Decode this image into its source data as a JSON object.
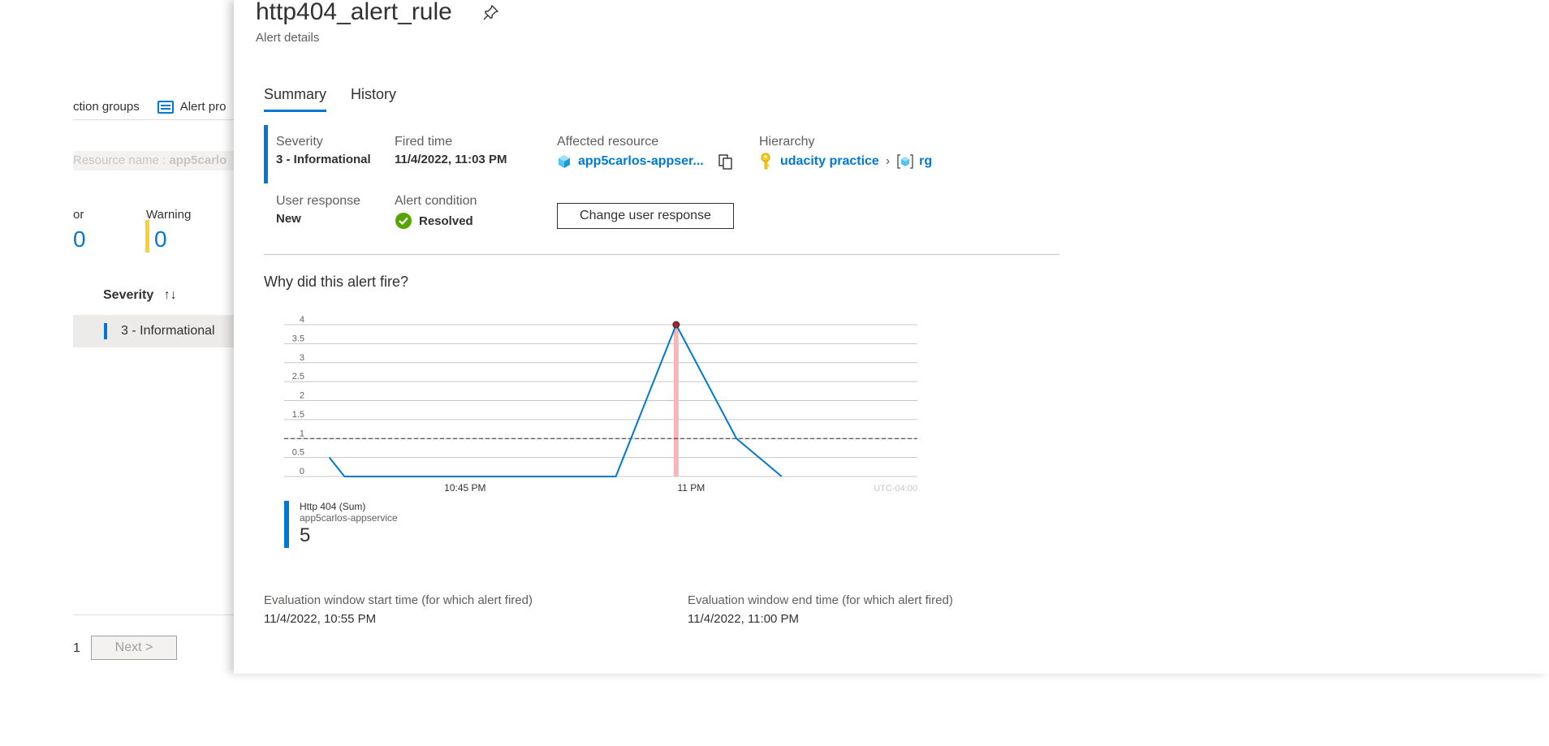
{
  "background": {
    "toolbar": {
      "action_groups": "ction groups",
      "alert_processing": "Alert pro"
    },
    "filter": {
      "prefix": "Resource name : ",
      "value": "app5carlo"
    },
    "stats": [
      {
        "label": "or",
        "value": "0"
      },
      {
        "label": "Warning",
        "value": "0"
      }
    ],
    "severity_header": "Severity",
    "sort_icon": "sort-updown-icon",
    "severity_row": "3 - Informational",
    "pagination": {
      "page": "1",
      "next_label": "Next >"
    }
  },
  "blade": {
    "title": "http404_alert_rule",
    "subtitle": "Alert details",
    "pin_icon": "pin-icon",
    "tabs": [
      {
        "label": "Summary",
        "active": true
      },
      {
        "label": "History",
        "active": false
      }
    ],
    "summary": {
      "severity": {
        "label": "Severity",
        "value": "3 - Informational"
      },
      "fired_time": {
        "label": "Fired time",
        "value": "11/4/2022, 11:03 PM"
      },
      "affected_resource": {
        "label": "Affected resource",
        "value": "app5carlos-appser..."
      },
      "hierarchy": {
        "label": "Hierarchy",
        "subscription": "udacity practice",
        "resource_group": "rg"
      },
      "user_response": {
        "label": "User response",
        "value": "New"
      },
      "alert_condition": {
        "label": "Alert condition",
        "value": "Resolved"
      },
      "change_button": "Change user response"
    },
    "why_heading": "Why did this alert fire?",
    "legend": {
      "metric": "Http 404 (Sum)",
      "resource": "app5carlos-appservice",
      "value": "5"
    },
    "evaluation": {
      "start_label": "Evaluation window start time (for which alert fired)",
      "start_value": "11/4/2022, 10:55 PM",
      "end_label": "Evaluation window end time (for which alert fired)",
      "end_value": "11/4/2022, 11:00 PM"
    }
  },
  "colors": {
    "accent": "#0078d4",
    "warning": "#f8d22a",
    "resolved": "#57a300",
    "threshold_marker": "#f4b6b9",
    "peak_point": "#a4262c"
  },
  "chart_data": {
    "type": "line",
    "x": [
      "10:36 PM",
      "10:37 PM",
      "10:40 PM",
      "10:45 PM",
      "10:50 PM",
      "10:55 PM",
      "10:59 PM",
      "11:03 PM",
      "11:06 PM"
    ],
    "series": [
      {
        "name": "Http 404 (Sum)",
        "values": [
          0.5,
          0,
          0,
          0,
          0,
          0,
          4,
          1,
          0
        ]
      }
    ],
    "threshold": 1,
    "fired_at": "10:59 PM",
    "yticks": [
      "0",
      "0.5",
      "1",
      "1.5",
      "2",
      "2.5",
      "3",
      "3.5",
      "4"
    ],
    "xticks": [
      "10:45 PM",
      "11 PM"
    ],
    "timezone_label": "UTC-04:00",
    "ylim": [
      0,
      4
    ],
    "grid": true
  }
}
